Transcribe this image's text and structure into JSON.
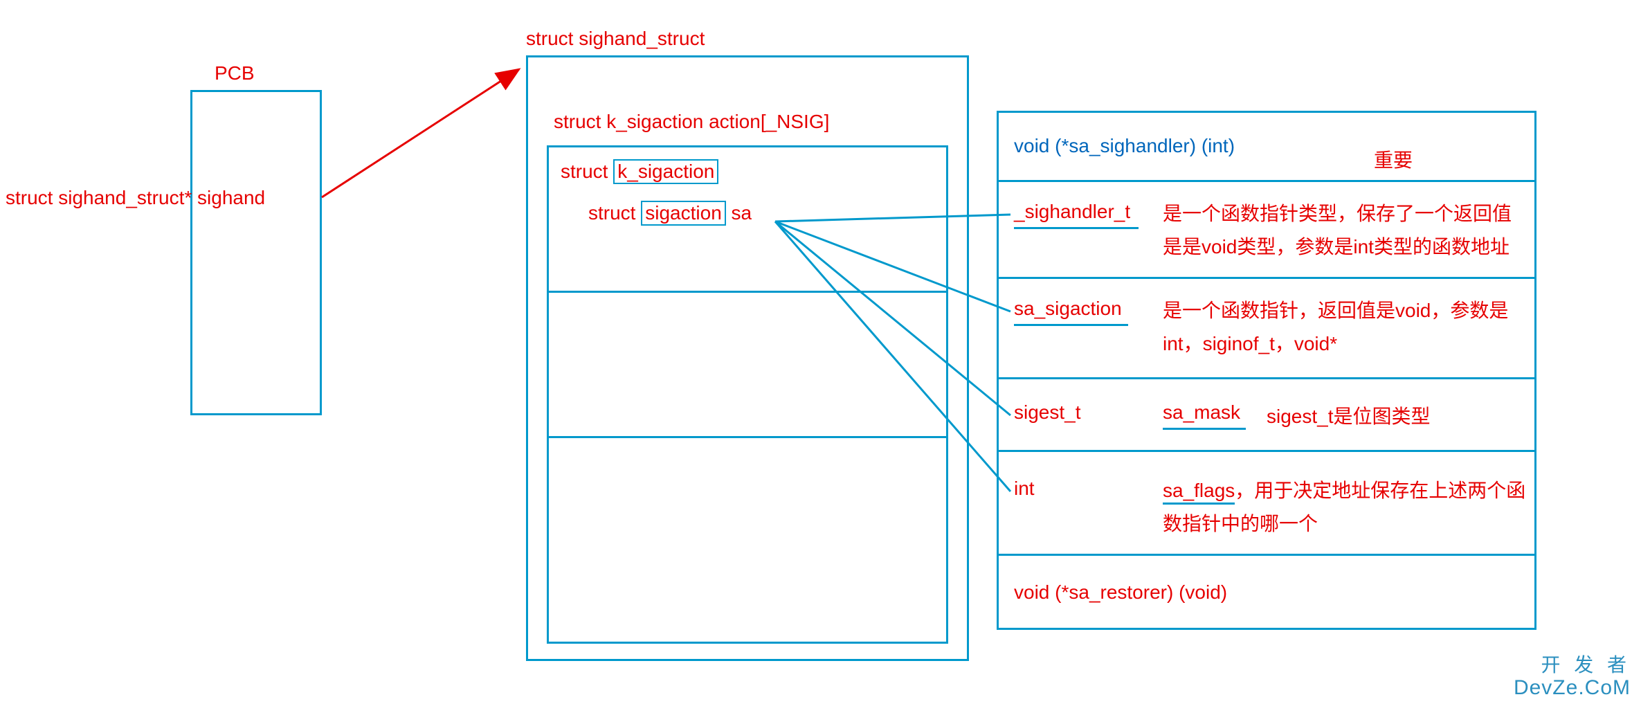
{
  "pcb": {
    "label": "PCB",
    "member": "struct sighand_struct* sighand"
  },
  "sighand": {
    "title": "struct sighand_struct",
    "array_label": "struct k_sigaction  action[_NSIG]",
    "row0_prefix": "struct",
    "row0_boxed": "k_sigaction",
    "row1_prefix": "struct",
    "row1_boxed": "sigaction",
    "row1_suffix": "sa"
  },
  "detail": {
    "header_sig": "void (*sa_sighandler) (int)",
    "important": "重要",
    "rows": [
      {
        "left": "_sighandler_t",
        "right": "是一个函数指针类型，保存了一个返回值是是void类型，参数是int类型的函数地址"
      },
      {
        "left": "sa_sigaction",
        "right": "是一个函数指针，返回值是void，参数是int，siginof_t，void*"
      },
      {
        "left": "sigest_t",
        "mid": "sa_mask",
        "right": "sigest_t是位图类型"
      },
      {
        "left": "int",
        "mid": "sa_flags",
        "right": "，用于决定地址保存在上述两个函数指针中的哪一个"
      },
      {
        "full": "void  (*sa_restorer) (void)"
      }
    ]
  },
  "watermark": {
    "line1": "开 发 者",
    "line2": "DevZe.CoM"
  }
}
